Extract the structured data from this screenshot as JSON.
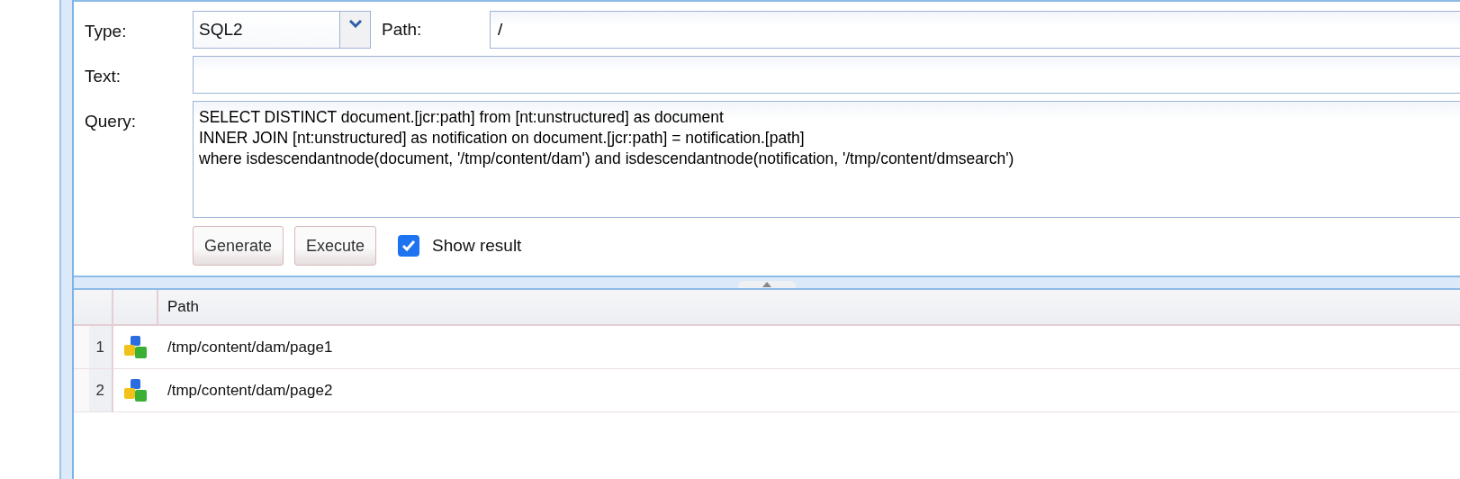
{
  "query_form": {
    "type_label": "Type:",
    "type_value": "SQL2",
    "path_label": "Path:",
    "path_value": "/",
    "text_label": "Text:",
    "query_label": "Query:",
    "query_value": "SELECT DISTINCT document.[jcr:path] from [nt:unstructured] as document\nINNER JOIN [nt:unstructured] as notification on document.[jcr:path] = notification.[path]\nwhere isdescendantnode(document, '/tmp/content/dam') and isdescendantnode(notification, '/tmp/content/dmsearch')",
    "buttons": [
      "Generate",
      "Execute"
    ],
    "show_result": {
      "label": "Show result",
      "checked": true
    }
  },
  "results": {
    "columns": [
      "Path"
    ],
    "rows": [
      {
        "number": "1",
        "path": "/tmp/content/dam/page1"
      },
      {
        "number": "2",
        "path": "/tmp/content/dam/page2"
      }
    ]
  }
}
